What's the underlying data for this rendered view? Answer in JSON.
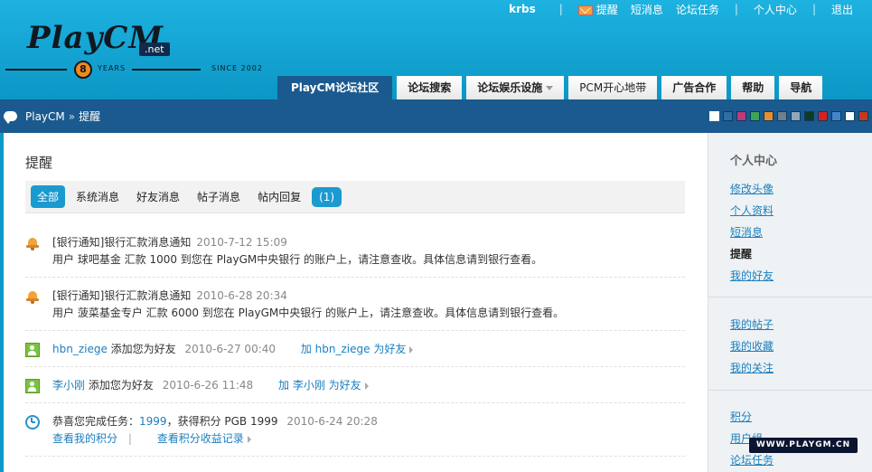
{
  "header": {
    "logo_text": "PlayCM",
    "logo_net": ".net",
    "logo_years_num": "8",
    "logo_years": "YEARS",
    "logo_since": "SINCE 2002",
    "username": "krbs",
    "top_links": {
      "reminder": "提醒",
      "messages": "短消息",
      "tasks": "论坛任务",
      "center": "个人中心",
      "logout": "退出"
    },
    "nav_tabs": [
      {
        "label": "PlayCM论坛社区"
      },
      {
        "label": "论坛搜索"
      },
      {
        "label": "论坛娱乐设施"
      },
      {
        "label": "PCM开心地带"
      },
      {
        "label": "广告合作"
      },
      {
        "label": "帮助"
      },
      {
        "label": "导航"
      }
    ]
  },
  "breadcrumb": {
    "home": "PlayCM",
    "sep": "»",
    "current": "提醒"
  },
  "theme_swatches": [
    "#ffffff",
    "#2f6fa6",
    "#c0397b",
    "#3fa35a",
    "#e7902a",
    "#6d7f91",
    "#8fa7b8",
    "#0f3b24",
    "#d82020",
    "#3f86cf",
    "#ffffff",
    "#c6391d"
  ],
  "main": {
    "title": "提醒",
    "filter_tabs": {
      "all": "全部",
      "system": "系统消息",
      "friend": "好友消息",
      "post": "帖子消息",
      "reply": "帖内回复",
      "count": "(1)"
    },
    "notices": [
      {
        "icon": "bell-icon",
        "title": "[银行通知]银行汇款消息通知",
        "date": "2010-7-12 15:09",
        "body": "用户 球吧基金 汇款 1000 到您在 PlayGM中央银行 的账户上，请注意查收。具体信息请到银行查看。"
      },
      {
        "icon": "bell-icon",
        "title": "[银行通知]银行汇款消息通知",
        "date": "2010-6-28 20:34",
        "body": "用户 菠菜基金专户 汇款 6000 到您在 PlayGM中央银行 的账户上，请注意查收。具体信息请到银行查看。"
      },
      {
        "icon": "friend-icon",
        "user": "hbn_ziege",
        "text": "添加您为好友",
        "date": "2010-6-27 00:40",
        "action": "加 hbn_ziege 为好友"
      },
      {
        "icon": "friend-icon",
        "user": "李小刚",
        "text": "添加您为好友",
        "date": "2010-6-26 11:48",
        "action": "加 李小刚 为好友"
      },
      {
        "icon": "clock-icon",
        "prefix": "恭喜您完成任务：",
        "task": "1999",
        "suffix": "，获得积分 PGB 1999",
        "date": "2010-6-24 20:28",
        "link1": "查看我的积分",
        "link_sep": "|",
        "link2": "查看积分收益记录"
      }
    ]
  },
  "sidebar": {
    "title": "个人中心",
    "group1": [
      "修改头像",
      "个人资料",
      "短消息",
      "提醒",
      "我的好友"
    ],
    "group2": [
      "我的帖子",
      "我的收藏",
      "我的关注"
    ],
    "group3": [
      "积分",
      "用户组",
      "论坛任务"
    ]
  },
  "watermark": "WWW.PLAYGM.CN"
}
